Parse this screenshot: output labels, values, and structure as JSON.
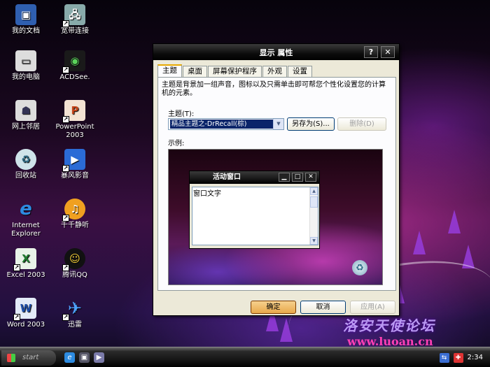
{
  "desktop": {
    "icons": [
      {
        "label": "我的文档",
        "glyph": "▣",
        "icon": "my-documents-icon"
      },
      {
        "label": "宽带连接",
        "glyph": "🖧",
        "icon": "broadband-icon"
      },
      {
        "label": "我的电脑",
        "glyph": "▭",
        "icon": "my-computer-icon"
      },
      {
        "label": "ACDSee.",
        "glyph": "◉",
        "icon": "acdsee-icon"
      },
      {
        "label": "网上邻居",
        "glyph": "☗",
        "icon": "network-icon"
      },
      {
        "label": "PowerPoint 2003",
        "glyph": "P",
        "icon": "powerpoint-icon"
      },
      {
        "label": "回收站",
        "glyph": "♻",
        "icon": "recycle-bin-icon"
      },
      {
        "label": "暴风影音",
        "glyph": "▶",
        "icon": "storm-player-icon"
      },
      {
        "label": "Internet Explorer",
        "glyph": "e",
        "icon": "ie-icon"
      },
      {
        "label": "千千静听",
        "glyph": "♫",
        "icon": "ttplayer-icon"
      },
      {
        "label": "Excel 2003",
        "glyph": "X",
        "icon": "excel-icon"
      },
      {
        "label": "腾讯QQ",
        "glyph": "☺",
        "icon": "qq-icon"
      },
      {
        "label": "Word 2003",
        "glyph": "W",
        "icon": "word-icon"
      },
      {
        "label": "迅雷",
        "glyph": "✈",
        "icon": "xunlei-icon"
      }
    ]
  },
  "dialog": {
    "title": "显示 属性",
    "help_btn": "?",
    "close_btn": "✕",
    "tabs": [
      "主题",
      "桌面",
      "屏幕保护程序",
      "外观",
      "设置"
    ],
    "active_tab": "主题",
    "description": "主题是背景加一组声音，图标以及只需单击即可帮您个性化设置您的计算机的元素。",
    "theme_label": "主题(T):",
    "theme_value": "精品主题之-DrRecall(棕)",
    "save_as_label": "另存为(S)...",
    "delete_label": "删除(D)",
    "sample_label": "示例:",
    "preview": {
      "window_title": "活动窗口",
      "window_text": "窗口文字",
      "min_btn": "▁",
      "max_btn": "□",
      "close_btn": "✕"
    },
    "ok_label": "确定",
    "cancel_label": "取消",
    "apply_label": "应用(A)"
  },
  "taskbar": {
    "start_label": "start",
    "clock": "2:34"
  },
  "watermark": {
    "text": "洛安天使论坛",
    "url": "www.luoan.cn"
  },
  "colors": {
    "accent": "#0a246a",
    "title_bar": "#000000",
    "dialog_bg": "#ece9d8",
    "watermark_url": "#ff3fb5"
  }
}
